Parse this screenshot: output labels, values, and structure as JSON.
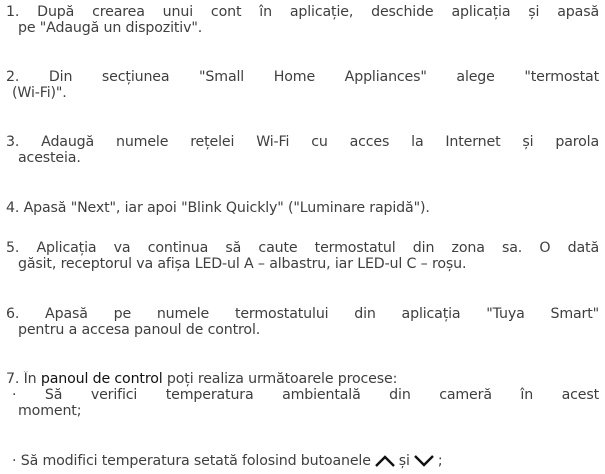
{
  "steps": [
    {
      "lines": [
        "1. După crearea unui cont în aplicație, deschide aplicația și apasă",
        "pe \"Adaugă un dispozitiv\"."
      ]
    },
    {
      "lines": [
        "2. Din secțiunea \"Small Home Appliances\" alege \"termostat",
        "(Wi-Fi)\"."
      ]
    },
    {
      "lines": [
        "3. Adaugă numele rețelei Wi-Fi cu acces la Internet și parola",
        "acesteia."
      ]
    },
    {
      "lines": [
        "4. Apasă \"Next\", iar apoi \"Blink Quickly\" (\"Luminare rapidă\")."
      ]
    },
    {
      "lines": [
        "5. Aplicația va continua să caute termostatul din zona sa. O dată",
        "găsit, receptorul va afișa LED-ul A – albastru, iar LED-ul C – roșu."
      ]
    },
    {
      "lines": [
        "6. Apasă pe numele termostatului din aplicația \"Tuya Smart\"",
        "pentru a accesa panoul de control."
      ]
    }
  ],
  "step7": {
    "prefix": "7. În ",
    "highlight": "panoul de control",
    "suffix": " poți realiza următoarele procese:",
    "bullet1": [
      "· Să verifici temperatura ambientală din cameră în acest",
      "moment;"
    ],
    "bullet2_text": "· Să modifici temperatura setată folosind butoanele",
    "bullet2_and": "și",
    "bullet2_end": ";",
    "up_icon": "chevron-up",
    "down_icon": "chevron-down"
  }
}
